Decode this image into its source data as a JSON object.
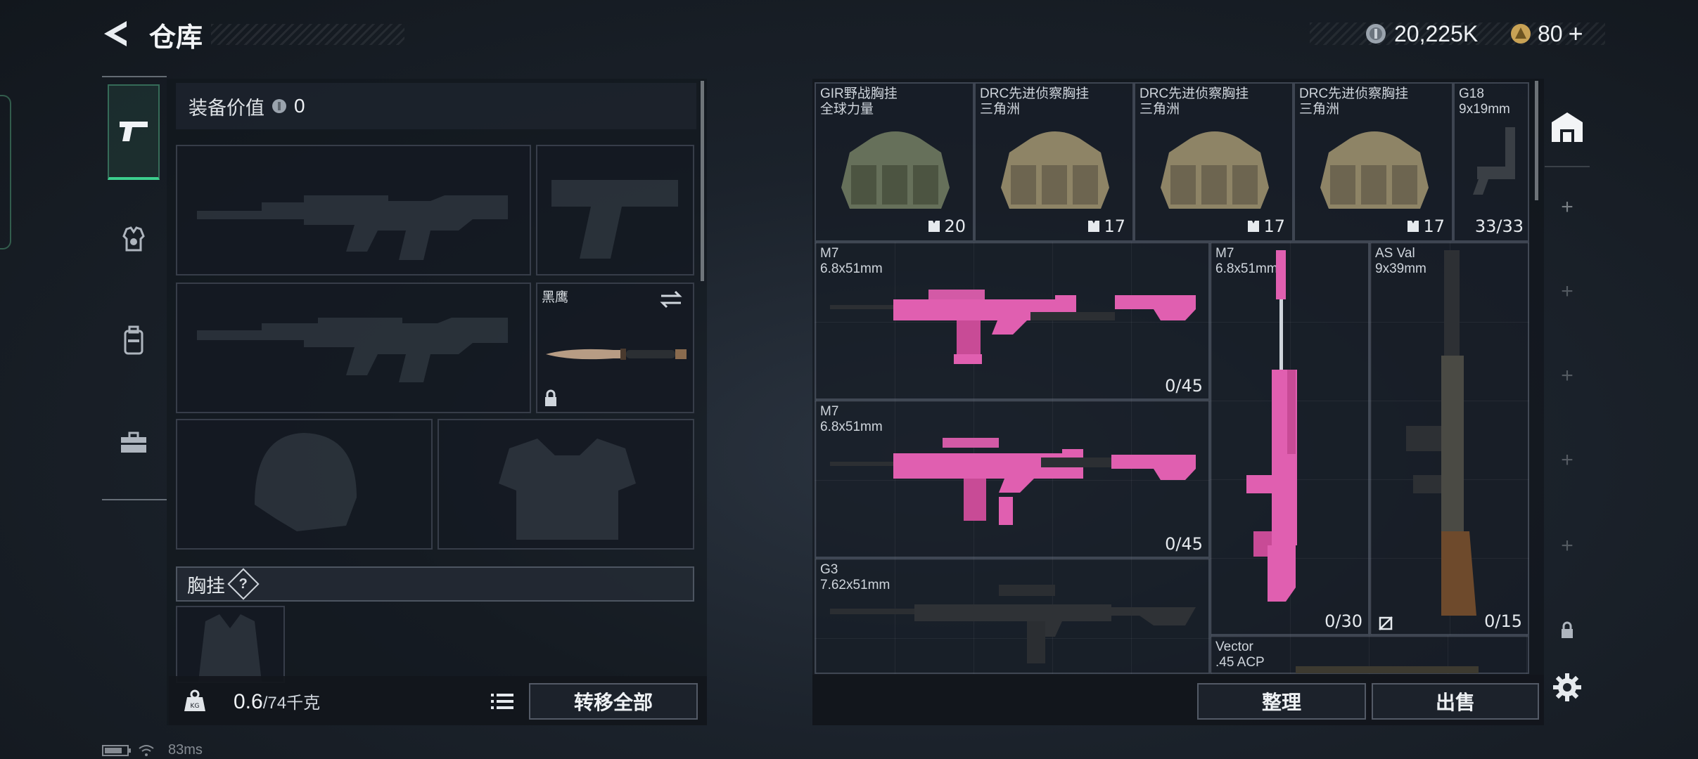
{
  "header": {
    "title": "仓库",
    "currency": "20,225K",
    "coins": "80",
    "coins_plus": "+"
  },
  "equipment": {
    "value_label": "装备价值",
    "value": "0",
    "melee_name": "黑鹰",
    "chest_rig_label": "胸挂",
    "help": "?"
  },
  "footer_left": {
    "weight_current": "0.6",
    "weight_total": "/74千克",
    "transfer_all": "转移全部"
  },
  "items": [
    {
      "name": "GIR野战胸挂\n全球力量",
      "count": "20"
    },
    {
      "name": "DRC先进侦察胸挂\n三角洲",
      "count": "17"
    },
    {
      "name": "DRC先进侦察胸挂\n三角洲",
      "count": "17"
    },
    {
      "name": "DRC先进侦察胸挂\n三角洲",
      "count": "17"
    },
    {
      "name": "G18\n9x19mm",
      "count": "33/33"
    },
    {
      "name": "M7\n6.8x51mm",
      "count": "0/45"
    },
    {
      "name": "M7\n6.8x51mm",
      "count": "0/30"
    },
    {
      "name": "AS Val\n9x39mm",
      "count": "0/15"
    },
    {
      "name": "M7\n6.8x51mm",
      "count": "0/45"
    },
    {
      "name": "G3\n7.62x51mm",
      "count": ""
    },
    {
      "name": "Vector\n.45 ACP",
      "count": ""
    }
  ],
  "footer_right": {
    "sort": "整理",
    "sell": "出售"
  },
  "status": {
    "ping": "83ms"
  },
  "colors": {
    "accent": "#3ccf8e",
    "camo_pink": "#e05fb0"
  }
}
